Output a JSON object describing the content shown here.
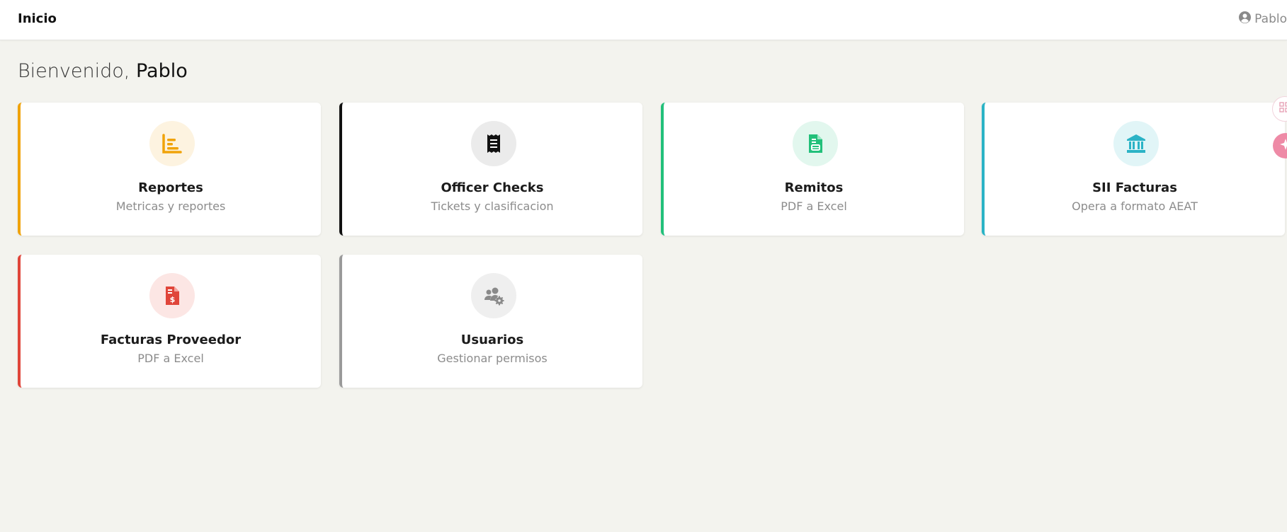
{
  "header": {
    "title": "Inicio",
    "user_name": "Pablo"
  },
  "welcome": {
    "prefix": "Bienvenido,",
    "name": "Pablo"
  },
  "cards": [
    {
      "title": "Reportes",
      "subtitle": "Metricas y reportes",
      "icon": "bar-chart-icon",
      "accent": "#f0a30a",
      "icon_bg": "#fdf3e0",
      "icon_color": "#f0a30a"
    },
    {
      "title": "Officer Checks",
      "subtitle": "Tickets y clasificacion",
      "icon": "receipt-icon",
      "accent": "#111111",
      "icon_bg": "#ebebeb",
      "icon_color": "#111111"
    },
    {
      "title": "Remitos",
      "subtitle": "PDF a Excel",
      "icon": "file-excel-icon",
      "accent": "#22c07a",
      "icon_bg": "#e2f7ee",
      "icon_color": "#22c07a"
    },
    {
      "title": "SII Facturas",
      "subtitle": "Opera a formato AEAT",
      "icon": "bank-icon",
      "accent": "#2bb3c6",
      "icon_bg": "#e1f5f7",
      "icon_color": "#2bb3c6"
    },
    {
      "title": "Facturas Proveedor",
      "subtitle": "PDF a Excel",
      "icon": "invoice-dollar-icon",
      "accent": "#e0453a",
      "icon_bg": "#fce6e4",
      "icon_color": "#e0453a"
    },
    {
      "title": "Usuarios",
      "subtitle": "Gestionar permisos",
      "icon": "users-cog-icon",
      "accent": "#9a9a9a",
      "icon_bg": "#efefef",
      "icon_color": "#8a8a8a"
    }
  ]
}
